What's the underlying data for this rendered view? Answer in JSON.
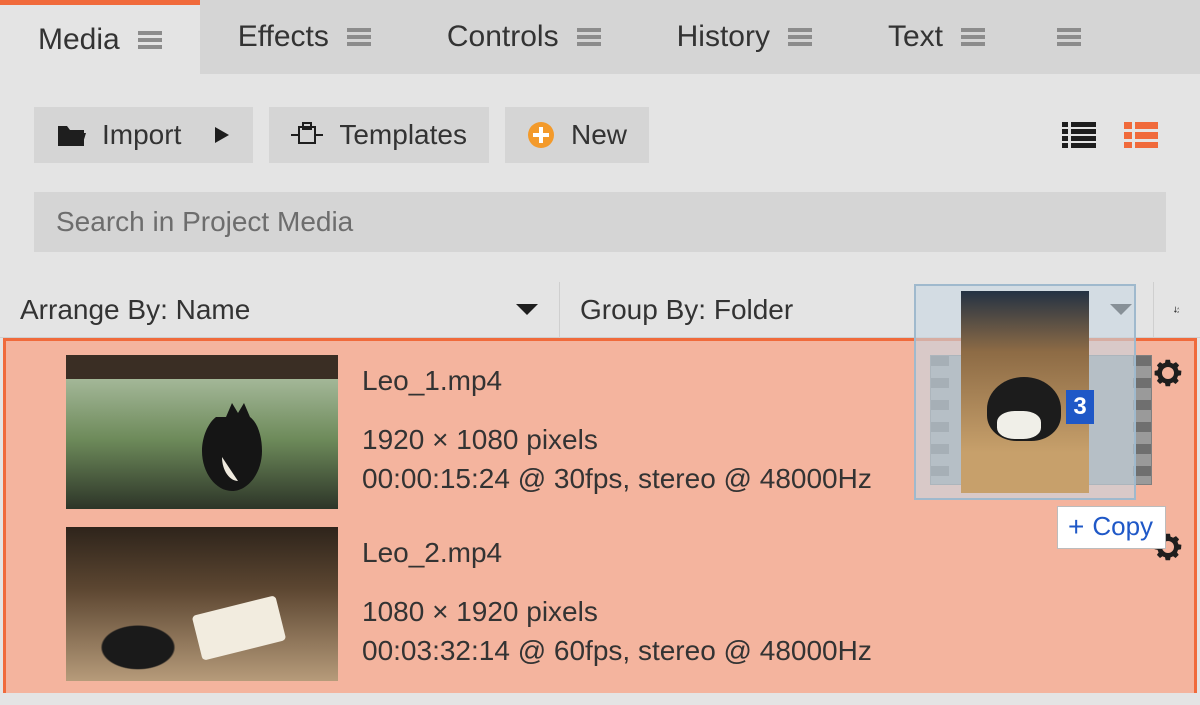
{
  "tabs": {
    "items": [
      "Media",
      "Effects",
      "Controls",
      "History",
      "Text"
    ],
    "active_index": 0
  },
  "toolbar": {
    "import_label": "Import",
    "templates_label": "Templates",
    "new_label": "New"
  },
  "search": {
    "placeholder": "Search in Project Media"
  },
  "sortbar": {
    "arrange_label": "Arrange By: Name",
    "group_label": "Group By: Folder"
  },
  "media": [
    {
      "filename": "Leo_1.mp4",
      "dimensions": "1920 × 1080 pixels",
      "details": "00:00:15:24 @ 30fps, stereo @ 48000Hz"
    },
    {
      "filename": "Leo_2.mp4",
      "dimensions": "1080 × 1920 pixels",
      "details": "00:03:32:14 @ 60fps, stereo @ 48000Hz"
    }
  ],
  "drag": {
    "count": "3",
    "copy_label": "Copy"
  }
}
